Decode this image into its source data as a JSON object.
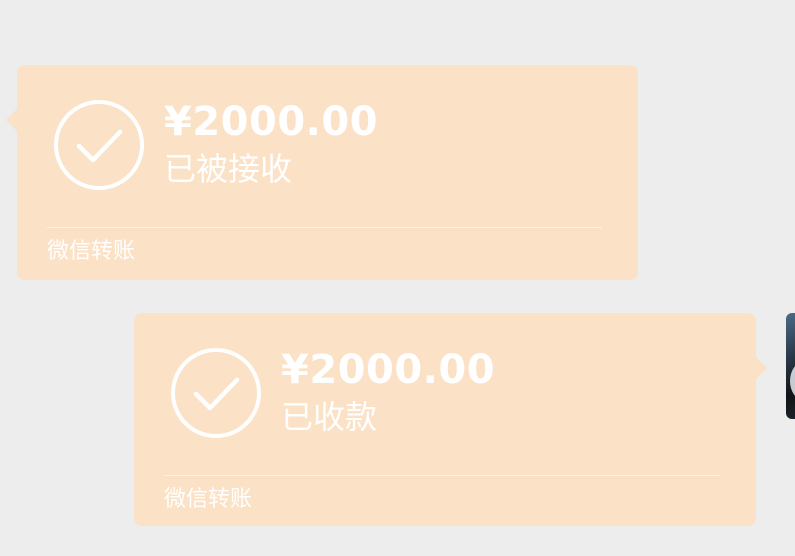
{
  "messages": [
    {
      "direction": "incoming",
      "amount": "¥2000.00",
      "status": "已被接收",
      "footer": "微信转账",
      "icon": "check-circle-icon"
    },
    {
      "direction": "outgoing",
      "amount": "¥2000.00",
      "status": "已收款",
      "footer": "微信转账",
      "icon": "check-circle-icon"
    }
  ],
  "colors": {
    "background": "#ededed",
    "bubble": "#fbe1c5",
    "text": "#ffffff"
  }
}
